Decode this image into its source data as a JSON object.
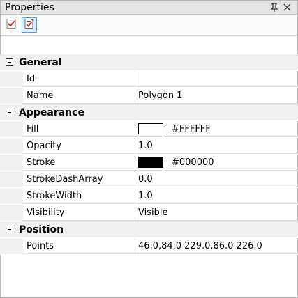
{
  "panel": {
    "title": "Properties",
    "pin_icon": "pin-icon",
    "close_icon": "close-icon"
  },
  "toolbar": {
    "buttons": [
      {
        "icon": "checklist-icon"
      },
      {
        "icon": "edit-checklist-icon"
      }
    ]
  },
  "categories": [
    {
      "label": "General",
      "properties": [
        {
          "name": "Id",
          "value": ""
        },
        {
          "name": "Name",
          "value": "Polygon 1"
        }
      ]
    },
    {
      "label": "Appearance",
      "properties": [
        {
          "name": "Fill",
          "value": "#FFFFFF",
          "swatch": "#FFFFFF"
        },
        {
          "name": "Opacity",
          "value": "1.0"
        },
        {
          "name": "Stroke",
          "value": "#000000",
          "swatch": "#000000"
        },
        {
          "name": "StrokeDashArray",
          "value": "0.0"
        },
        {
          "name": "StrokeWidth",
          "value": "1.0"
        },
        {
          "name": "Visibility",
          "value": "Visible"
        }
      ]
    },
    {
      "label": "Position",
      "properties": [
        {
          "name": "Points",
          "value": "46.0,84.0 229.0,86.0 226.0"
        }
      ]
    }
  ]
}
